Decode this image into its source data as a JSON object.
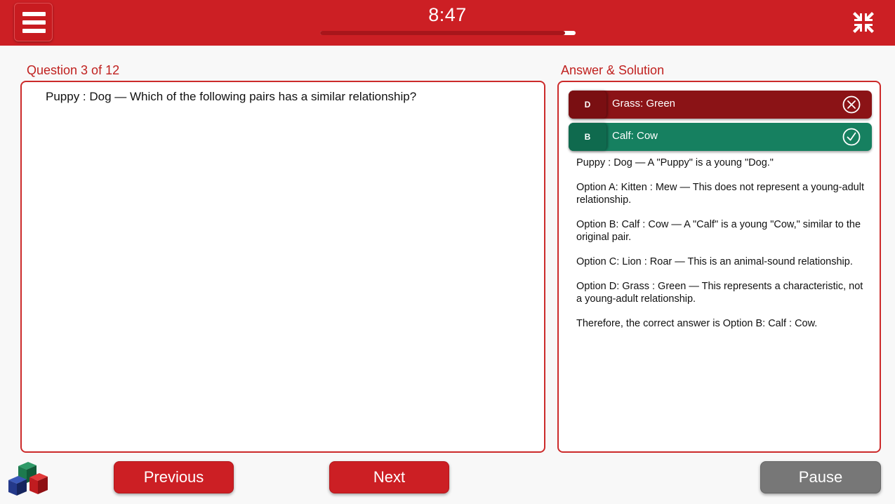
{
  "header": {
    "timer": "8:47",
    "progress": 0.96,
    "menu_icon": "hamburger-menu-icon",
    "collapse_icon": "collapse-arrows-icon"
  },
  "question": {
    "label": "Question 3 of 12",
    "text": "Puppy : Dog — Which of the following pairs has a similar relationship?"
  },
  "answer": {
    "label": "Answer & Solution",
    "options": [
      {
        "letter": "D",
        "text": "Grass: Green",
        "status": "wrong",
        "icon": "close-circle-icon"
      },
      {
        "letter": "B",
        "text": "Calf: Cow",
        "status": "correct",
        "icon": "check-circle-icon"
      }
    ],
    "solution": [
      "Puppy : Dog — A \"Puppy\" is a young \"Dog.\"",
      "Option A: Kitten : Mew — This does not represent a young-adult relationship.",
      "Option B: Calf : Cow — A \"Calf\" is a young \"Cow,\" similar to the original pair.",
      "Option C: Lion : Roar — This is an animal-sound relationship.",
      "Option D: Grass : Green — This represents a characteristic, not a young-adult relationship.",
      "Therefore, the correct answer is Option B: Calf : Cow."
    ]
  },
  "footer": {
    "previous_label": "Previous",
    "next_label": "Next",
    "pause_label": "Pause",
    "logo_icon": "cubes-logo-icon"
  },
  "colors": {
    "brand_red": "#cc1f24",
    "wrong": "#8b1316",
    "correct": "#168060",
    "pause_grey": "#777777"
  }
}
